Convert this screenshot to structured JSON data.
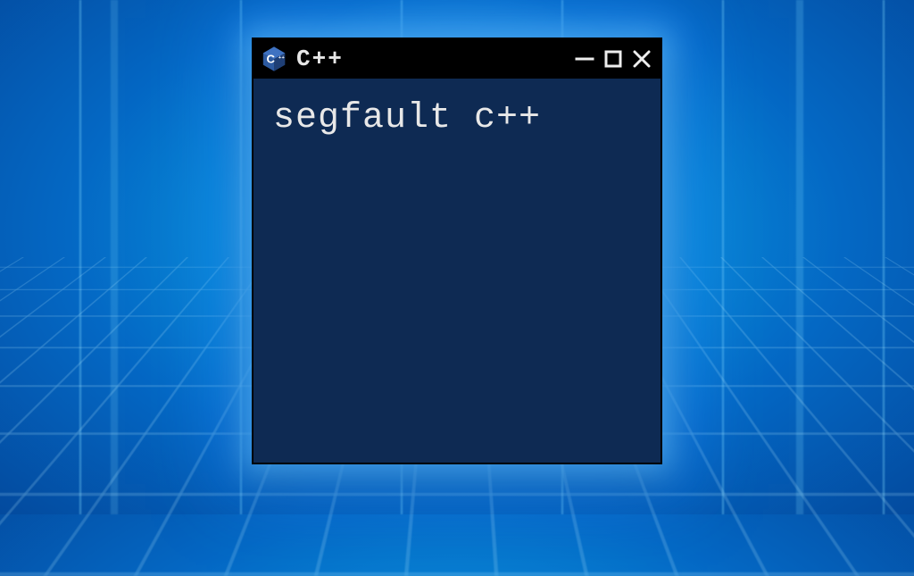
{
  "background": {
    "theme_primary": "#0a8fdb",
    "theme_glow": "#2ac5ff"
  },
  "terminal": {
    "title_bar": {
      "title_text": "C++",
      "controls": {
        "minimize": "minimize",
        "maximize": "maximize",
        "close": "close"
      }
    },
    "body": {
      "line1": "segfault c++"
    },
    "colors": {
      "title_bar_bg": "#000000",
      "body_bg": "#0e2a53",
      "text": "#e8e8e8"
    }
  }
}
